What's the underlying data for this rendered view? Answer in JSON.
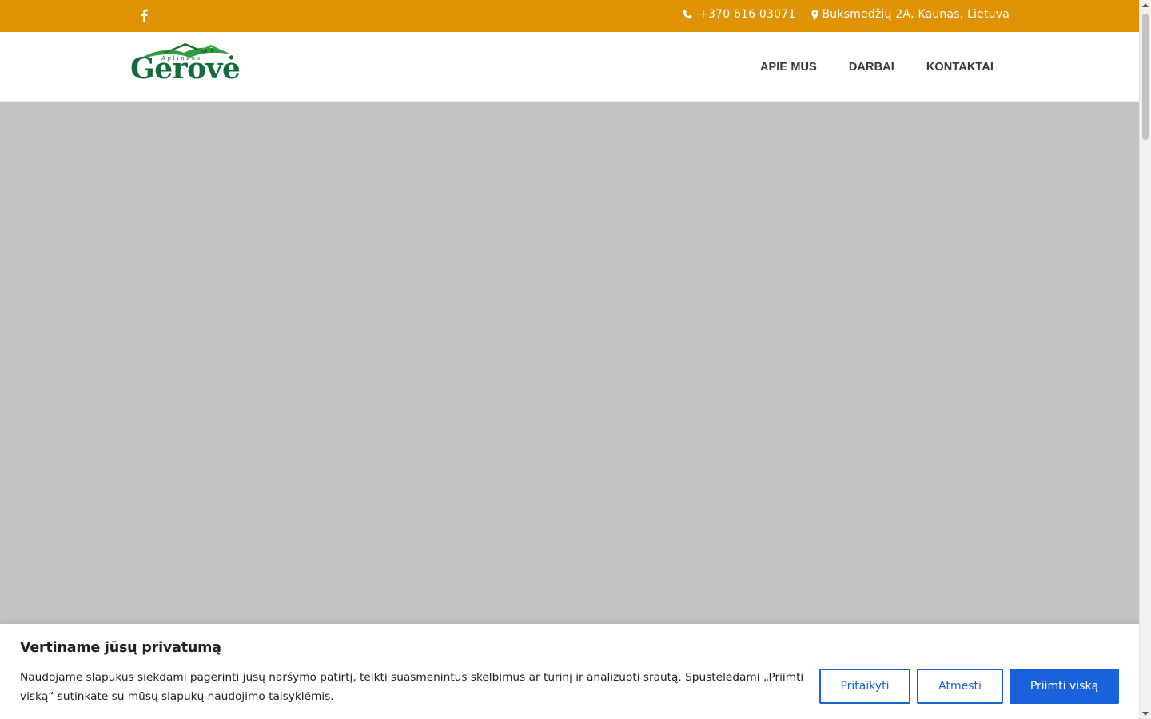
{
  "topbar": {
    "phone": "+370 616 03071",
    "address": "Buksmedžių 2A, Kaunas, Lietuva",
    "social_icon": "facebook-icon",
    "phone_icon": "phone-icon",
    "location_icon": "map-pin-icon"
  },
  "header": {
    "logo": {
      "subtitle": "Aplinkos",
      "title": "Gerovė"
    },
    "nav": [
      {
        "label": "APIE MUS"
      },
      {
        "label": "DARBAI"
      },
      {
        "label": "KONTAKTAI"
      }
    ]
  },
  "cookie_banner": {
    "title": "Vertiname jūsų privatumą",
    "text": "Naudojame slapukus siekdami pagerinti jūsų naršymo patirtį, teikti suasmenintus skelbimus ar turinį ir analizuoti srautą. Spustelėdami „Priimti viską“ sutinkate su mūsų slapukų naudojimo taisyklėmis.",
    "customize_label": "Pritaikyti",
    "reject_label": "Atmesti",
    "accept_label": "Priimti viską"
  },
  "colors": {
    "topbar": "#e09205",
    "brand_green": "#116b3a",
    "hero_placeholder": "#c3c3c3",
    "button_blue": "#1863dc"
  }
}
